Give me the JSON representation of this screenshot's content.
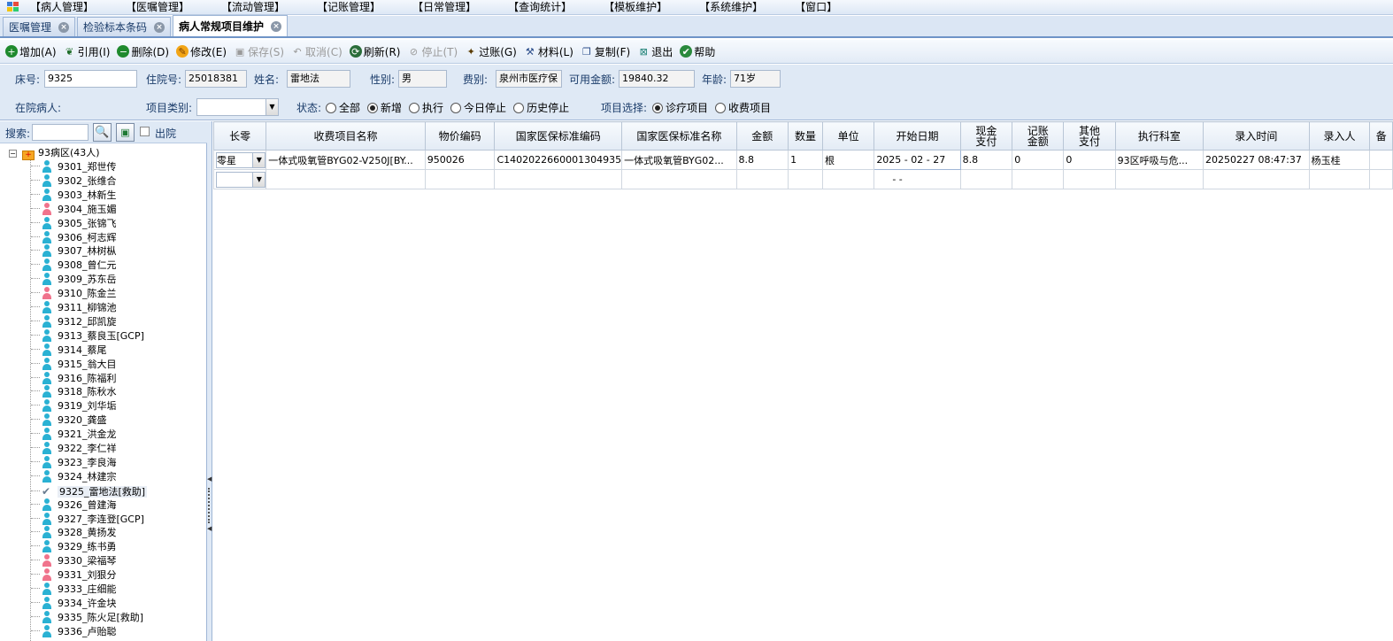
{
  "menu": [
    "【病人管理】",
    "【医嘱管理】",
    "【流动管理】",
    "【记账管理】",
    "【日常管理】",
    "【查询统计】",
    "【模板维护】",
    "【系统维护】",
    "【窗口】"
  ],
  "tabs": [
    {
      "label": "医嘱管理",
      "active": false
    },
    {
      "label": "检验标本条码",
      "active": false
    },
    {
      "label": "病人常规项目维护",
      "active": true
    }
  ],
  "toolbar": [
    {
      "label": "增加(A)",
      "icon": "add-icon",
      "enabled": true
    },
    {
      "label": "引用(I)",
      "icon": "reference-icon",
      "enabled": true
    },
    {
      "label": "删除(D)",
      "icon": "delete-icon",
      "enabled": true
    },
    {
      "label": "修改(E)",
      "icon": "edit-icon",
      "enabled": true
    },
    {
      "label": "保存(S)",
      "icon": "save-icon",
      "enabled": false
    },
    {
      "label": "取消(C)",
      "icon": "cancel-icon",
      "enabled": false
    },
    {
      "label": "刷新(R)",
      "icon": "refresh-icon",
      "enabled": true
    },
    {
      "label": "停止(T)",
      "icon": "stop-icon",
      "enabled": false
    },
    {
      "label": "过账(G)",
      "icon": "post-icon",
      "enabled": true
    },
    {
      "label": "材料(L)",
      "icon": "material-icon",
      "enabled": true
    },
    {
      "label": "复制(F)",
      "icon": "copy-icon",
      "enabled": true
    },
    {
      "label": "退出",
      "icon": "exit-icon",
      "enabled": true
    },
    {
      "label": "帮助",
      "icon": "help-icon",
      "enabled": true
    }
  ],
  "patient": {
    "bed_label": "床号:",
    "bed": "9325",
    "hosp_label": "住院号:",
    "hosp_no": "25018381",
    "name_label": "姓名:",
    "name": "雷地法",
    "sex_label": "性别:",
    "sex": "男",
    "fee_label": "费别:",
    "fee": "泉州市医疗保",
    "balance_label": "可用金额:",
    "balance": "19840.32",
    "age_label": "年龄:",
    "age": "71岁",
    "inpatient_label": "在院病人:",
    "category_label": "项目类别:",
    "category": ""
  },
  "status": {
    "label": "状态:",
    "options": [
      "全部",
      "新增",
      "执行",
      "今日停止",
      "历史停止"
    ],
    "selected": "新增"
  },
  "item_select": {
    "label": "项目选择:",
    "options": [
      "诊疗项目",
      "收费项目"
    ],
    "selected": "诊疗项目"
  },
  "search": {
    "label": "搜索:",
    "value": "",
    "discharged_label": "出院"
  },
  "tree": {
    "root": "93病区(43人)",
    "patients": [
      {
        "label": "9301_郑世传",
        "color": "#2ab1d3"
      },
      {
        "label": "9302_张维合",
        "color": "#2ab1d3"
      },
      {
        "label": "9303_林新生",
        "color": "#2ab1d3"
      },
      {
        "label": "9304_施玉媚",
        "color": "#f0738c"
      },
      {
        "label": "9305_张锦飞",
        "color": "#2ab1d3"
      },
      {
        "label": "9306_柯志辉",
        "color": "#2ab1d3"
      },
      {
        "label": "9307_林树枞",
        "color": "#2ab1d3"
      },
      {
        "label": "9308_曾仁元",
        "color": "#2ab1d3"
      },
      {
        "label": "9309_苏东岳",
        "color": "#2ab1d3"
      },
      {
        "label": "9310_陈金兰",
        "color": "#f0738c"
      },
      {
        "label": "9311_柳锦池",
        "color": "#2ab1d3"
      },
      {
        "label": "9312_邱凯旋",
        "color": "#2ab1d3"
      },
      {
        "label": "9313_蔡良玉[GCP]",
        "color": "#2ab1d3"
      },
      {
        "label": "9314_蔡尾",
        "color": "#2ab1d3"
      },
      {
        "label": "9315_翁大目",
        "color": "#2ab1d3"
      },
      {
        "label": "9316_陈福利",
        "color": "#2ab1d3"
      },
      {
        "label": "9318_陈秋水",
        "color": "#2ab1d3"
      },
      {
        "label": "9319_刘华垢",
        "color": "#2ab1d3"
      },
      {
        "label": "9320_龚盛",
        "color": "#2ab1d3"
      },
      {
        "label": "9321_洪金龙",
        "color": "#2ab1d3"
      },
      {
        "label": "9322_李仁祥",
        "color": "#2ab1d3"
      },
      {
        "label": "9323_李良海",
        "color": "#2ab1d3"
      },
      {
        "label": "9324_林建宗",
        "color": "#2ab1d3"
      },
      {
        "label": "9325_雷地法[救助]",
        "color": "selected"
      },
      {
        "label": "9326_曾建海",
        "color": "#2ab1d3"
      },
      {
        "label": "9327_李连登[GCP]",
        "color": "#2ab1d3"
      },
      {
        "label": "9328_黄扬发",
        "color": "#2ab1d3"
      },
      {
        "label": "9329_练书勇",
        "color": "#2ab1d3"
      },
      {
        "label": "9330_梁福琴",
        "color": "#f0738c"
      },
      {
        "label": "9331_刘狠分",
        "color": "#f0738c"
      },
      {
        "label": "9333_庄细能",
        "color": "#2ab1d3"
      },
      {
        "label": "9334_许金块",
        "color": "#2ab1d3"
      },
      {
        "label": "9335_陈火足[救助]",
        "color": "#2ab1d3"
      },
      {
        "label": "9336_卢贻聪",
        "color": "#2ab1d3"
      }
    ]
  },
  "table": {
    "columns": [
      "长零",
      "收费项目名称",
      "物价编码",
      "国家医保标准编码",
      "国家医保标准名称",
      "金额",
      "数量",
      "单位",
      "开始日期",
      "现金\n支付",
      "记账\n金额",
      "其他\n支付",
      "执行科室",
      "录入时间",
      "录入人",
      "备"
    ],
    "rows": [
      [
        "零星",
        "一体式吸氧管BYG02-V250J[BY...",
        "950026",
        "C1402022660001304935",
        "一体式吸氧管BYG02...",
        "8.8",
        "1",
        "根",
        "2025 - 02 - 27",
        "8.8",
        "0",
        "0",
        "93区呼吸与危...",
        "20250227 08:47:37",
        "杨玉桂",
        ""
      ]
    ],
    "new_row_date": "-  -"
  }
}
